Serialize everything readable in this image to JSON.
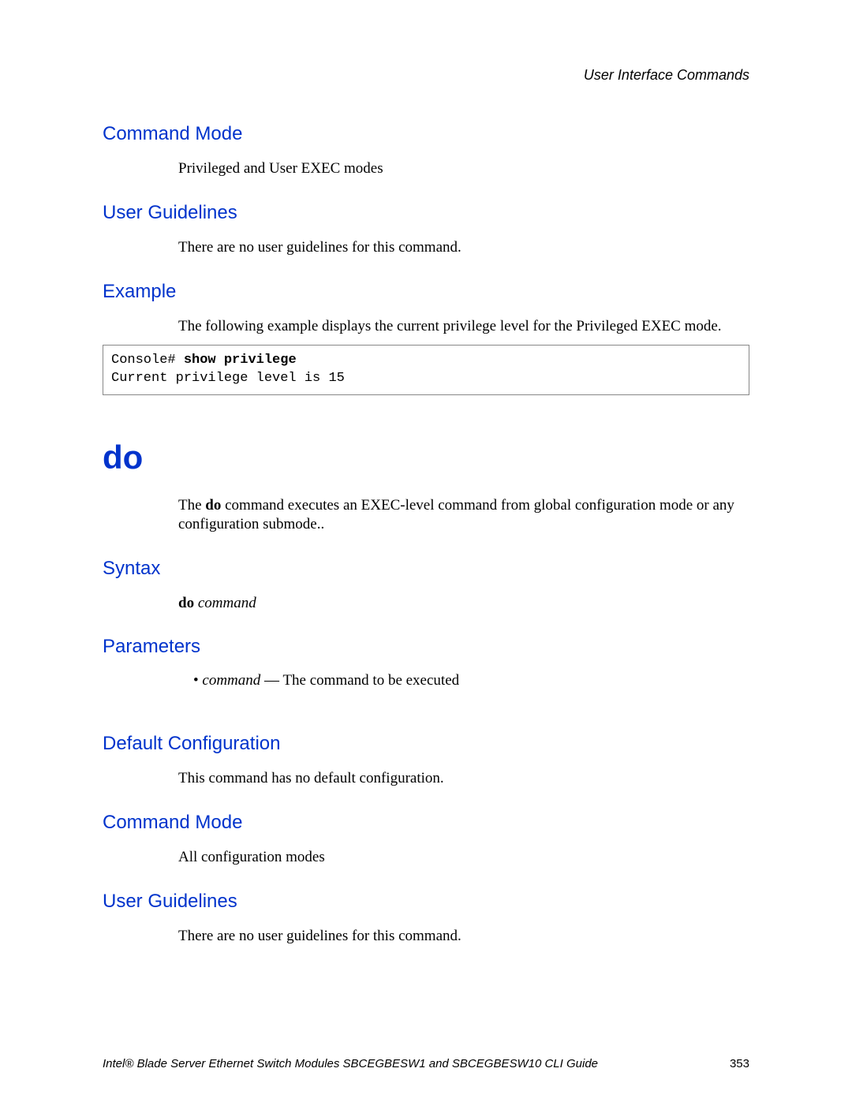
{
  "header": {
    "right": "User Interface Commands"
  },
  "sections": {
    "cmdMode1": {
      "title": "Command Mode",
      "text": "Privileged and User EXEC modes"
    },
    "userGuide1": {
      "title": "User Guidelines",
      "text": "There are no user guidelines for this command."
    },
    "example": {
      "title": "Example",
      "intro": "The following example displays the current privilege level for the Privileged EXEC mode.",
      "code_prefix": "Console# ",
      "code_cmd": "show privilege",
      "code_output": "Current privilege level is 15"
    },
    "doCmd": {
      "title": "do",
      "desc_pre": "The ",
      "desc_bold": "do",
      "desc_post": " command executes an EXEC-level command from global configuration mode or any configuration submode.."
    },
    "syntax": {
      "title": "Syntax",
      "bold": "do",
      "italic": " command"
    },
    "params": {
      "title": "Parameters",
      "bullet_italic": "command",
      "bullet_rest": " — The command to be executed"
    },
    "defCfg": {
      "title": "Default Configuration",
      "text": "This command has no default configuration."
    },
    "cmdMode2": {
      "title": "Command Mode",
      "text": "All configuration modes"
    },
    "userGuide2": {
      "title": "User Guidelines",
      "text": "There are no user guidelines for this command."
    }
  },
  "footer": {
    "text": "Intel® Blade Server Ethernet Switch Modules SBCEGBESW1 and SBCEGBESW10 CLI Guide",
    "page": "353"
  }
}
